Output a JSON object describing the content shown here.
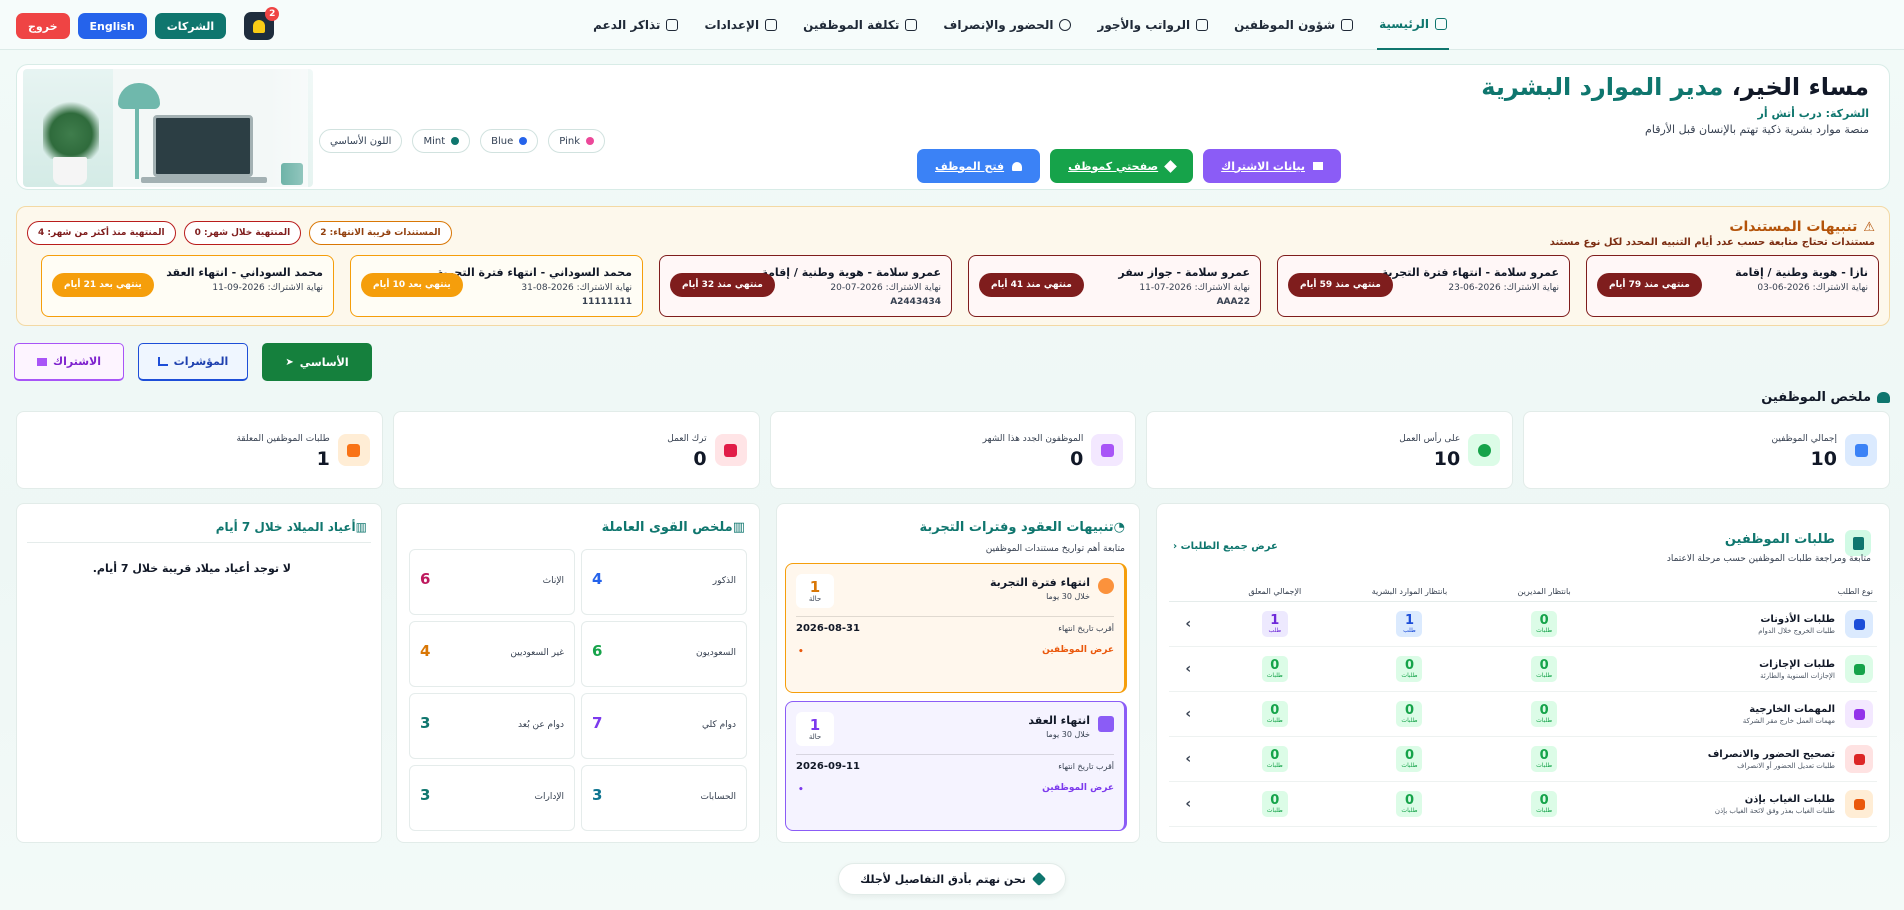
{
  "nav": {
    "items": [
      {
        "label": "الرئيسية"
      },
      {
        "label": "شؤون الموظفين"
      },
      {
        "label": "الرواتب والأجور"
      },
      {
        "label": "الحضور والإنصراف"
      },
      {
        "label": "تكلفة الموظفين"
      },
      {
        "label": "الإعدادات"
      },
      {
        "label": "تذاكر الدعم"
      }
    ],
    "notifications_count": "2",
    "companies_label": "الشركات",
    "language_label": "English",
    "logout_label": "خروج"
  },
  "hero": {
    "greeting": "مساء الخير،",
    "role": "مدير الموارد البشرية",
    "company": "الشركة: درب أتش أر",
    "tagline": "منصة موارد بشرية ذكية تهتم بالإنسان قبل الأرقام",
    "buttons": {
      "subscription": "بيانات الاشتراك",
      "my_page": "صفحتي كموظف",
      "open_employee": "فتح الموظف"
    },
    "themes": [
      "Pink",
      "Blue",
      "Mint",
      "اللون الأساسي"
    ]
  },
  "documents": {
    "title": "تنبيهات المستندات",
    "subtitle": "مستندات تحتاج متابعة حسب عدد أيام التنبيه المحدد لكل نوع مستند",
    "pills": {
      "expiring": "المستندات قريبة الانتهاء: 2",
      "expired_month": "المنتهية خلال شهر: 0",
      "expired_older": "المنتهية منذ أكثر من شهر: 4"
    },
    "cards": [
      {
        "title": "نازا - هوية وطنية / إقامة",
        "date": "نهاية الاشتراك: 2026-06-03",
        "number": "",
        "badge": "منتهي منذ 79 أيام",
        "status": "expired"
      },
      {
        "title": "عمرو سلامة - انتهاء فترة التجربة",
        "date": "نهاية الاشتراك: 2026-06-23",
        "number": "",
        "badge": "منتهي منذ 59 أيام",
        "status": "expired"
      },
      {
        "title": "عمرو سلامة - جواز سفر",
        "date": "نهاية الاشتراك: 2026-07-11",
        "number": "AAA22",
        "badge": "منتهي منذ 41 أيام",
        "status": "expired"
      },
      {
        "title": "عمرو سلامة - هوية وطنية / إقامة",
        "date": "نهاية الاشتراك: 2026-07-20",
        "number": "A2443434",
        "badge": "منتهي منذ 32 أيام",
        "status": "expired"
      },
      {
        "title": "محمد السوداني - انتهاء فترة التجربة",
        "date": "نهاية الاشتراك: 2026-08-31",
        "number": "11111111",
        "badge": "ينتهي بعد 10 أيام",
        "status": "soon"
      },
      {
        "title": "محمد السوداني - انتهاء العقد",
        "date": "نهاية الاشتراك: 2026-09-11",
        "number": "",
        "badge": "ينتهي بعد 21 أيام",
        "status": "soon"
      }
    ]
  },
  "tabs": {
    "main": "الأساسي",
    "indicators": "المؤشرات",
    "subscription": "الاشتراك"
  },
  "summary": {
    "title": "ملخص الموظفين",
    "stats": [
      {
        "label": "إجمالي الموظفين",
        "value": "10"
      },
      {
        "label": "على رأس العمل",
        "value": "10"
      },
      {
        "label": "الموظفون الجدد هذا الشهر",
        "value": "0"
      },
      {
        "label": "ترك العمل",
        "value": "0"
      },
      {
        "label": "طلبات الموظفين المعلقة",
        "value": "1"
      }
    ]
  },
  "requests": {
    "title": "طلبات الموظفين",
    "subtitle": "متابعة ومراجعة طلبات الموظفين حسب مرحلة الاعتماد",
    "view_all": "عرض جميع الطلبات",
    "headers": [
      "نوع الطلب",
      "بانتظار المديرين",
      "بانتظار الموارد البشرية",
      "الإجمالي المعلق"
    ],
    "unit": "طلب",
    "unit_plural": "طلبات",
    "rows": [
      {
        "name": "طلبات الأذونات",
        "desc": "طلبات الخروج خلال الدوام",
        "managers": "0",
        "hr": "1",
        "total": "1"
      },
      {
        "name": "طلبات الإجازات",
        "desc": "الإجازات السنوية والطارئة",
        "managers": "0",
        "hr": "0",
        "total": "0"
      },
      {
        "name": "المهمات الخارجية",
        "desc": "مهمات العمل خارج مقر الشركة",
        "managers": "0",
        "hr": "0",
        "total": "0"
      },
      {
        "name": "تصحيح الحضور والانصراف",
        "desc": "طلبات تعديل الحضور أو الانصراف",
        "managers": "0",
        "hr": "0",
        "total": "0"
      },
      {
        "name": "طلبات الغياب بإذن",
        "desc": "طلبات الغياب بعذر وفق لائحة الغياب بإذن",
        "managers": "0",
        "hr": "0",
        "total": "0"
      }
    ]
  },
  "contracts": {
    "title": "تنبيهات العقود وفترات التجربة",
    "subtitle": "متابعة أهم تواريخ مستندات الموظفين",
    "cards": [
      {
        "name": "انتهاء فترة التجربة",
        "within": "خلال 30 يوما",
        "count": "1",
        "unit": "حالة",
        "nearest_label": "أقرب تاريخ انتهاء",
        "date": "2026-08-31",
        "view": "عرض الموظفين",
        "dot": "•"
      },
      {
        "name": "انتهاء العقد",
        "within": "خلال 30 يوما",
        "count": "1",
        "unit": "حالة",
        "nearest_label": "أقرب تاريخ انتهاء",
        "date": "2026-09-11",
        "view": "عرض الموظفين",
        "dot": "•"
      }
    ]
  },
  "workforce": {
    "title": "ملخص القوى العاملة",
    "cells": [
      {
        "label": "الذكور",
        "value": "4",
        "color": "#2563eb"
      },
      {
        "label": "الإناث",
        "value": "6",
        "color": "#be185d"
      },
      {
        "label": "السعوديون",
        "value": "6",
        "color": "#16a34a"
      },
      {
        "label": "غير السعوديين",
        "value": "4",
        "color": "#d97706"
      },
      {
        "label": "دوام كلي",
        "value": "7",
        "color": "#7c3aed"
      },
      {
        "label": "دوام عن بُعد",
        "value": "3",
        "color": "#0f766e"
      },
      {
        "label": "الحسابات",
        "value": "3",
        "color": "#0e7490"
      },
      {
        "label": "الإدارات",
        "value": "3",
        "color": "#0f766e"
      }
    ]
  },
  "birthdays": {
    "title": "أعياد الميلاد خلال 7 أيام",
    "empty": "لا توجد أعياد ميلاد قريبة خلال 7 أيام."
  },
  "footer": {
    "text": "نحن نهتم بأدق التفاصيل لأجلك"
  },
  "colors": {
    "brand": "#0f766e",
    "danger": "#ef4444",
    "expired_badge": "#7f1d1d",
    "soon_badge": "#f59e0b"
  }
}
